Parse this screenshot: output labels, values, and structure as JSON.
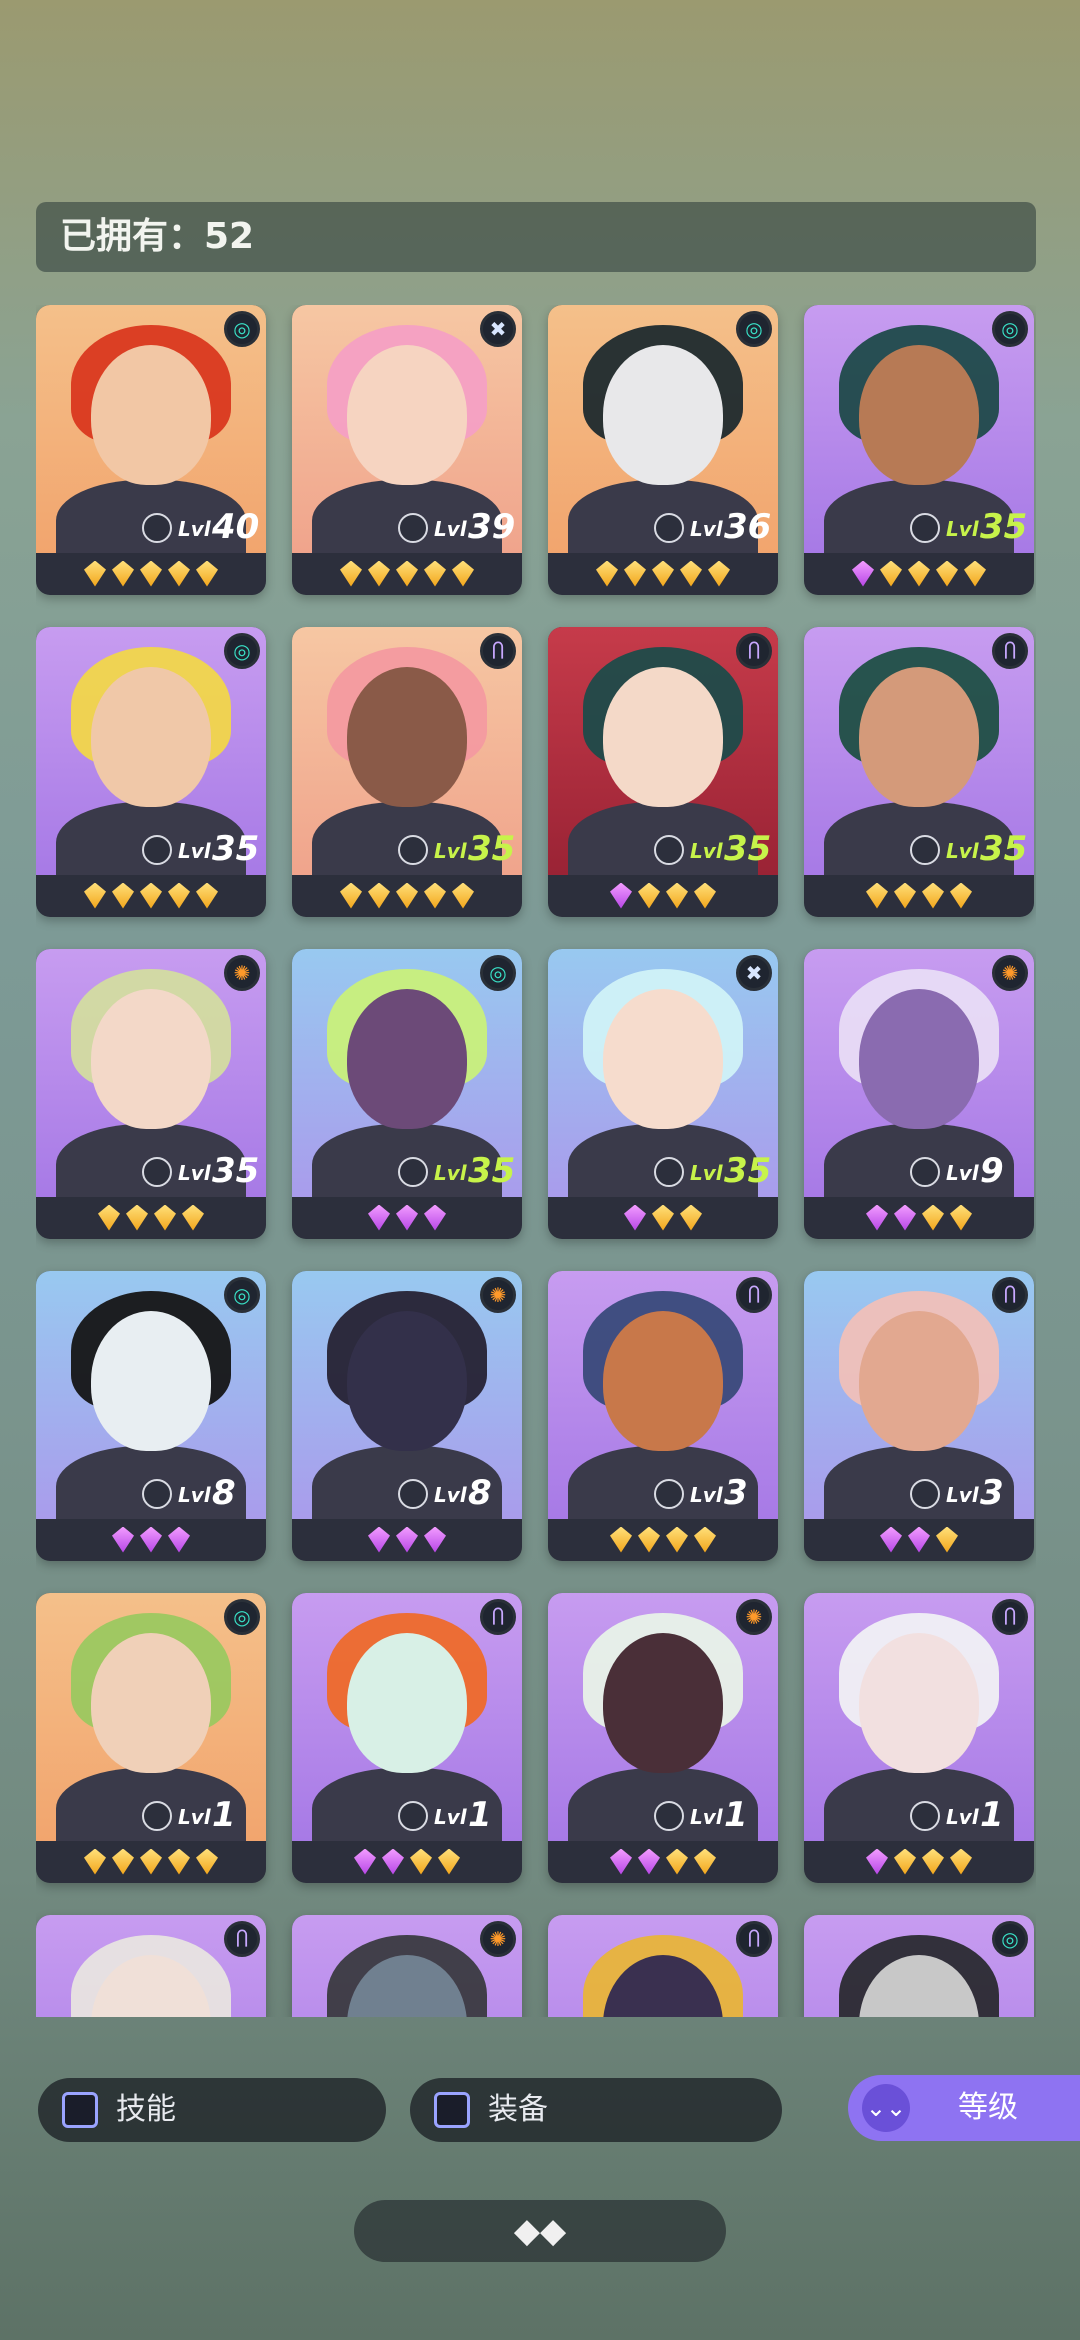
{
  "owned": {
    "label": "已拥有：52"
  },
  "heroes": [
    {
      "level_prefix": "Lvl",
      "level": "40",
      "element": "wind",
      "element_icon": "◎",
      "bg": "orange",
      "hair": "#d9381f",
      "skin": "#f2c7a5",
      "level_color": "white",
      "gems": [
        "gold",
        "gold",
        "gold",
        "gold",
        "gold"
      ]
    },
    {
      "level_prefix": "Lvl",
      "level": "39",
      "element": "cross",
      "element_icon": "✖",
      "bg": "pink",
      "hair": "#f4a0c4",
      "skin": "#f6d4c1",
      "level_color": "white",
      "gems": [
        "gold",
        "gold",
        "gold",
        "gold",
        "gold"
      ]
    },
    {
      "level_prefix": "Lvl",
      "level": "36",
      "element": "wind",
      "element_icon": "◎",
      "bg": "orange",
      "hair": "#1e2a2e",
      "skin": "#e8e8ea",
      "level_color": "white",
      "gems": [
        "gold",
        "gold",
        "gold",
        "gold",
        "gold"
      ]
    },
    {
      "level_prefix": "Lvl",
      "level": "35",
      "element": "wind",
      "element_icon": "◎",
      "bg": "purple",
      "hair": "#1f4a4a",
      "skin": "#b77a55",
      "level_color": "green",
      "gems": [
        "purple",
        "gold",
        "gold",
        "gold",
        "gold"
      ]
    },
    {
      "level_prefix": "Lvl",
      "level": "35",
      "element": "wind",
      "element_icon": "◎",
      "bg": "purple",
      "hair": "#f1d64a",
      "skin": "#f0c8a8",
      "level_color": "white",
      "gems": [
        "gold",
        "gold",
        "gold",
        "gold",
        "gold"
      ]
    },
    {
      "level_prefix": "Lvl",
      "level": "35",
      "element": "arcane",
      "element_icon": "Ⴖ",
      "bg": "pink",
      "hair": "#f39aa0",
      "skin": "#8a5a48",
      "level_color": "green",
      "gems": [
        "gold",
        "gold",
        "gold",
        "gold",
        "gold"
      ]
    },
    {
      "level_prefix": "Lvl",
      "level": "35",
      "element": "arcane",
      "element_icon": "Ⴖ",
      "bg": "red",
      "hair": "#1d4b4a",
      "skin": "#f4d9c8",
      "level_color": "green",
      "gems": [
        "purple",
        "gold",
        "gold",
        "gold"
      ]
    },
    {
      "level_prefix": "Lvl",
      "level": "35",
      "element": "arcane",
      "element_icon": "Ⴖ",
      "bg": "purple",
      "hair": "#1f4f45",
      "skin": "#d49a7a",
      "level_color": "green",
      "gems": [
        "gold",
        "gold",
        "gold",
        "gold"
      ]
    },
    {
      "level_prefix": "Lvl",
      "level": "35",
      "element": "sun",
      "element_icon": "✺",
      "bg": "purple",
      "hair": "#d3dca0",
      "skin": "#f3d8c8",
      "level_color": "white",
      "gems": [
        "gold",
        "gold",
        "gold",
        "gold"
      ]
    },
    {
      "level_prefix": "Lvl",
      "level": "35",
      "element": "wind",
      "element_icon": "◎",
      "bg": "blue",
      "hair": "#c9f07a",
      "skin": "#6c4a78",
      "level_color": "green",
      "gems": [
        "purple",
        "purple",
        "purple"
      ]
    },
    {
      "level_prefix": "Lvl",
      "level": "35",
      "element": "cross",
      "element_icon": "✖",
      "bg": "blue",
      "hair": "#d0f2f7",
      "skin": "#f6dccd",
      "level_color": "green",
      "gems": [
        "purple",
        "gold",
        "gold"
      ]
    },
    {
      "level_prefix": "Lvl",
      "level": "9",
      "element": "sun",
      "element_icon": "✺",
      "bg": "purple",
      "hair": "#e8dcf6",
      "skin": "#8a6bb0",
      "level_color": "white",
      "gems": [
        "purple",
        "purple",
        "gold",
        "gold"
      ]
    },
    {
      "level_prefix": "Lvl",
      "level": "8",
      "element": "wind",
      "element_icon": "◎",
      "bg": "blue",
      "hair": "#151515",
      "skin": "#e8eef2",
      "level_color": "white",
      "gems": [
        "purple",
        "purple",
        "purple"
      ]
    },
    {
      "level_prefix": "Lvl",
      "level": "8",
      "element": "sun",
      "element_icon": "✺",
      "bg": "blue",
      "hair": "#262233",
      "skin": "#33304a",
      "level_color": "white",
      "gems": [
        "purple",
        "purple",
        "purple"
      ]
    },
    {
      "level_prefix": "Lvl",
      "level": "3",
      "element": "arcane",
      "element_icon": "Ⴖ",
      "bg": "purple",
      "hair": "#394a7a",
      "skin": "#c8784a",
      "level_color": "white",
      "gems": [
        "gold",
        "gold",
        "gold",
        "gold"
      ]
    },
    {
      "level_prefix": "Lvl",
      "level": "3",
      "element": "arcane",
      "element_icon": "Ⴖ",
      "bg": "blue",
      "hair": "#f0c0b8",
      "skin": "#e2a890",
      "level_color": "white",
      "gems": [
        "purple",
        "purple",
        "gold"
      ]
    },
    {
      "level_prefix": "Lvl",
      "level": "1",
      "element": "wind",
      "element_icon": "◎",
      "bg": "orange",
      "hair": "#9bc860",
      "skin": "#f0d0b8",
      "level_color": "white",
      "gems": [
        "gold",
        "gold",
        "gold",
        "gold",
        "gold"
      ]
    },
    {
      "level_prefix": "Lvl",
      "level": "1",
      "element": "arcane",
      "element_icon": "Ⴖ",
      "bg": "purple",
      "hair": "#ee6a2a",
      "skin": "#d8f0e6",
      "level_color": "white",
      "gems": [
        "purple",
        "purple",
        "gold",
        "gold"
      ]
    },
    {
      "level_prefix": "Lvl",
      "level": "1",
      "element": "sun",
      "element_icon": "✺",
      "bg": "purple",
      "hair": "#e8f2e8",
      "skin": "#4a2f38",
      "level_color": "white",
      "gems": [
        "purple",
        "purple",
        "gold",
        "gold"
      ]
    },
    {
      "level_prefix": "Lvl",
      "level": "1",
      "element": "arcane",
      "element_icon": "Ⴖ",
      "bg": "purple",
      "hair": "#f0f0f4",
      "skin": "#f2e0e0",
      "level_color": "white",
      "gems": [
        "purple",
        "gold",
        "gold",
        "gold"
      ]
    },
    {
      "level_prefix": "",
      "level": "",
      "element": "arcane",
      "element_icon": "Ⴖ",
      "bg": "purple",
      "hair": "#e8e4e0",
      "skin": "#f0e0d8",
      "level_color": "white",
      "gems": []
    },
    {
      "level_prefix": "",
      "level": "",
      "element": "sun",
      "element_icon": "✺",
      "bg": "purple",
      "hair": "#3a3a40",
      "skin": "#708090",
      "level_color": "white",
      "gems": []
    },
    {
      "level_prefix": "",
      "level": "",
      "element": "arcane",
      "element_icon": "Ⴖ",
      "bg": "purple",
      "hair": "#e8b43a",
      "skin": "#3a3050",
      "level_color": "white",
      "gems": []
    },
    {
      "level_prefix": "",
      "level": "",
      "element": "wind",
      "element_icon": "◎",
      "bg": "purple",
      "hair": "#2a2a30",
      "skin": "#c8c8c8",
      "level_color": "white",
      "gems": []
    }
  ],
  "filters": {
    "skill_label": "技能",
    "equipment_label": "装备",
    "sort_label": "等级",
    "sort_icon": "⌄⌄",
    "collapse_icon": "◆◆"
  }
}
